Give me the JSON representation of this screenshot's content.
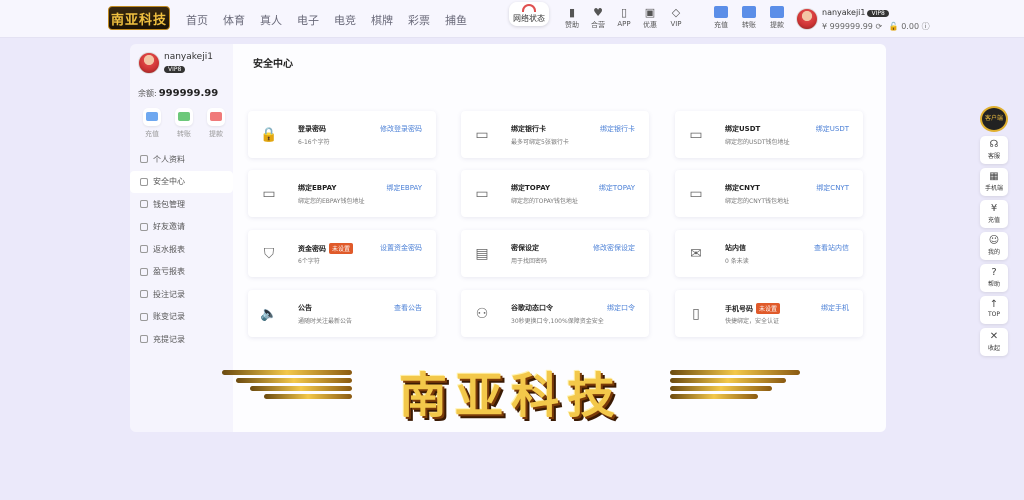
{
  "header": {
    "logo_text": "南亚科技",
    "nav": [
      "首页",
      "体育",
      "真人",
      "电子",
      "电竞",
      "棋牌",
      "彩票",
      "捕鱼"
    ],
    "network_label": "网络状态",
    "icons_a": [
      {
        "label": "赞助",
        "icon": "bookmark-icon"
      },
      {
        "label": "合营",
        "icon": "heart-icon"
      },
      {
        "label": "APP",
        "icon": "phone-icon"
      },
      {
        "label": "优惠",
        "icon": "gift-icon"
      },
      {
        "label": "VIP",
        "icon": "diamond-icon"
      }
    ],
    "icons_b": [
      {
        "label": "充值",
        "icon": "deposit-icon"
      },
      {
        "label": "转账",
        "icon": "transfer-icon"
      },
      {
        "label": "提款",
        "icon": "withdraw-icon"
      }
    ],
    "username": "nanyakeji1",
    "vip_badge": "VIP8",
    "balance": "¥ 999999.99",
    "points": "0.00"
  },
  "sidebar": {
    "username": "nanyakeji1",
    "vip_badge": "VIP8",
    "balance_label": "余额:",
    "balance_value": "999999.99",
    "actions": [
      {
        "label": "充值",
        "color": "#6ea8f0"
      },
      {
        "label": "转账",
        "color": "#6cc87a"
      },
      {
        "label": "提款",
        "color": "#f07a7a"
      }
    ],
    "menu": [
      "个人资料",
      "安全中心",
      "钱包管理",
      "好友邀请",
      "返水报表",
      "盈亏报表",
      "投注记录",
      "账变记录",
      "充提记录"
    ],
    "active_index": 1
  },
  "main": {
    "title": "安全中心",
    "cards": [
      {
        "title": "登录密码",
        "desc": "6-16个字符",
        "link": "修改登录密码",
        "icon": "lock-icon",
        "glyph": "🔒",
        "badge": ""
      },
      {
        "title": "绑定银行卡",
        "desc": "最多可绑定5张银行卡",
        "link": "绑定银行卡",
        "icon": "card-icon",
        "glyph": "▭",
        "badge": ""
      },
      {
        "title": "绑定USDT",
        "desc": "绑定您的USDT钱包地址",
        "link": "绑定USDT",
        "icon": "card-icon",
        "glyph": "▭",
        "badge": ""
      },
      {
        "title": "绑定EBPAY",
        "desc": "绑定您的EBPAY钱包地址",
        "link": "绑定EBPAY",
        "icon": "card-icon",
        "glyph": "▭",
        "badge": ""
      },
      {
        "title": "绑定TOPAY",
        "desc": "绑定您的TOPAY钱包地址",
        "link": "绑定TOPAY",
        "icon": "card-icon",
        "glyph": "▭",
        "badge": ""
      },
      {
        "title": "绑定CNYT",
        "desc": "绑定您的CNYT钱包地址",
        "link": "绑定CNYT",
        "icon": "card-icon",
        "glyph": "▭",
        "badge": ""
      },
      {
        "title": "资金密码",
        "desc": "6个字符",
        "link": "设置资金密码",
        "icon": "shield-icon",
        "glyph": "⛉",
        "badge": "未设置"
      },
      {
        "title": "密保设定",
        "desc": "用于找回密码",
        "link": "修改密保设定",
        "icon": "document-icon",
        "glyph": "▤",
        "badge": ""
      },
      {
        "title": "站内信",
        "desc": "0 条未读",
        "link": "查看站内信",
        "icon": "mail-icon",
        "glyph": "✉",
        "badge": ""
      },
      {
        "title": "公告",
        "desc": "通随时关注最新公告",
        "link": "查看公告",
        "icon": "speaker-icon",
        "glyph": "🔈",
        "badge": ""
      },
      {
        "title": "谷歌动态口令",
        "desc": "30秒更换口令,100%保障资金安全",
        "link": "绑定口令",
        "icon": "robot-icon",
        "glyph": "⚇",
        "badge": ""
      },
      {
        "title": "手机号码",
        "desc": "快捷绑定，安全认证",
        "link": "绑定手机",
        "icon": "mobile-icon",
        "glyph": "▯",
        "badge": "未设置"
      }
    ]
  },
  "watermark_text": "南亚科技",
  "float": {
    "top_label": "客户端",
    "items": [
      {
        "label": "客服",
        "icon": "headset-icon",
        "glyph": "☊"
      },
      {
        "label": "手机端",
        "icon": "qrcode-icon",
        "glyph": "▦"
      },
      {
        "label": "充值",
        "icon": "wallet-icon",
        "glyph": "¥"
      },
      {
        "label": "我的",
        "icon": "user-icon",
        "glyph": "☺"
      },
      {
        "label": "帮助",
        "icon": "help-icon",
        "glyph": "?"
      },
      {
        "label": "TOP",
        "icon": "arrow-up-icon",
        "glyph": "↑"
      },
      {
        "label": "收起",
        "icon": "collapse-icon",
        "glyph": "✕"
      }
    ]
  }
}
